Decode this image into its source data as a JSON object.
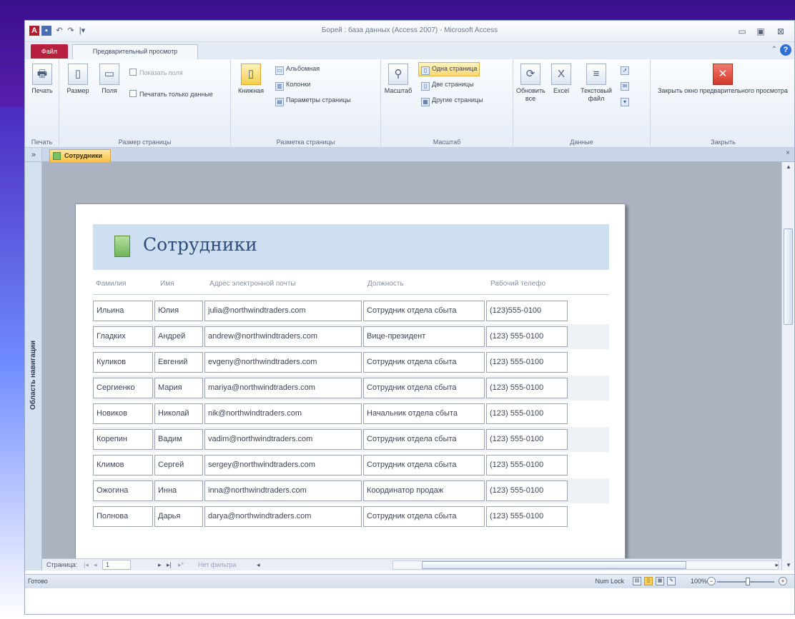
{
  "titlebar": {
    "title": "Борей : база данных (Access 2007) - Microsoft Access",
    "app_icon": "A",
    "save_icon": "▪",
    "undo_icon": "↶",
    "redo_icon": "↷",
    "qat_more": "|▾",
    "minimize": "▭",
    "maximize": "▣",
    "close": "⊠"
  },
  "tabs": {
    "file": "Файл",
    "preview": "Предварительный просмотр",
    "ribbon_minimize": "⌃",
    "help": "?"
  },
  "ribbon": {
    "print_group": {
      "label": "Печать",
      "print": "Печать",
      "icon": "🖶"
    },
    "page_size_group": {
      "label": "Размер страницы",
      "size": "Размер",
      "margins": "Поля",
      "show_margins": "Показать поля",
      "print_data_only": "Печатать только данные"
    },
    "layout_group": {
      "label": "Разметка страницы",
      "portrait": "Книжная",
      "landscape": "Альбомная",
      "columns": "Колонки",
      "page_setup": "Параметры страницы"
    },
    "zoom_group": {
      "label": "Масштаб",
      "zoom": "Масштаб",
      "one_page": "Одна страница",
      "two_pages": "Две страницы",
      "more_pages": "Другие страницы"
    },
    "data_group": {
      "label": "Данные",
      "refresh": "Обновить все",
      "excel": "Excel",
      "text_file": "Текстовый файл"
    },
    "close_group": {
      "label": "Закрыть",
      "close_preview": "Закрыть окно предварительного просмотра"
    }
  },
  "nav_pane": {
    "toggle": "»",
    "label": "Область навигации"
  },
  "doc_tab": {
    "label": "Сотрудники",
    "close": "×"
  },
  "report": {
    "title": "Сотрудники",
    "columns": [
      "Фамилия",
      "Имя",
      "Адрес электронной почты",
      "Должность",
      "Рабочий телефо"
    ],
    "rows": [
      [
        "Ильина",
        "Юлия",
        "julia@northwindtraders.com",
        "Сотрудник отдела сбыта",
        "(123)555-0100"
      ],
      [
        "Гладких",
        "Андрей",
        "andrew@northwindtraders.com",
        "Вице-президент",
        "(123) 555-0100"
      ],
      [
        "Куликов",
        "Евгений",
        "evgeny@northwindtraders.com",
        "Сотрудник отдела сбыта",
        "(123) 555-0100"
      ],
      [
        "Сергиенко",
        "Мария",
        "mariya@northwindtraders.com",
        "Сотрудник отдела сбыта",
        "(123) 555-0100"
      ],
      [
        "Новиков",
        "Николай",
        "nik@northwindtraders.com",
        "Начальник отдела сбыта",
        "(123) 555-0100"
      ],
      [
        "Корепин",
        "Вадим",
        "vadim@northwindtraders.com",
        "Сотрудник отдела сбыта",
        "(123) 555-0100"
      ],
      [
        "Климов",
        "Сергей",
        "sergey@northwindtraders.com",
        "Сотрудник отдела сбыта",
        "(123) 555-0100"
      ],
      [
        "Ожогина",
        "Инна",
        "inna@northwindtraders.com",
        "Координатор продаж",
        "(123) 555-0100"
      ],
      [
        "Полнова",
        "Дарья",
        "darya@northwindtraders.com",
        "Сотрудник отдела сбыта",
        "(123) 555-0100"
      ]
    ]
  },
  "record_nav": {
    "label": "Страница:",
    "first": "|◂",
    "prev": "◂",
    "current": "1",
    "next": "▸",
    "last": "▸|",
    "new": "▸*",
    "filter": "Нет фильтра",
    "scroll_left": "◂",
    "scroll_right": "▸"
  },
  "status": {
    "ready": "Готово",
    "numlock": "Num Lock",
    "zoom": "100%",
    "zoom_minus": "−",
    "zoom_plus": "+"
  }
}
